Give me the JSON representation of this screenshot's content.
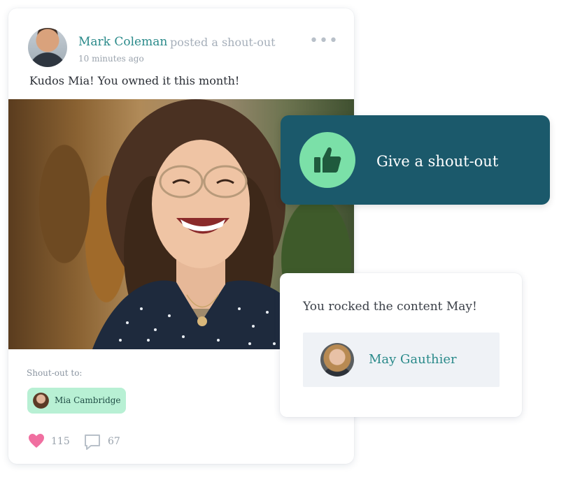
{
  "post": {
    "author_name": "Mark Coleman",
    "action_text": "posted a shout-out",
    "timestamp": "10 minutes ago",
    "more_icon": "ellipsis-icon",
    "message": "Kudos Mia! You owned it this month!",
    "shoutout_label": "Shout-out to:",
    "shoutout_recipient": "Mia Cambridge",
    "likes": "115",
    "comments": "67"
  },
  "cta": {
    "label": "Give a shout-out",
    "icon": "thumbs-up-icon",
    "bg_color": "#1b596b",
    "icon_bg_color": "#7be0a8"
  },
  "mini_card": {
    "message": "You rocked the content May!",
    "recipient_name": "May Gauthier"
  },
  "colors": {
    "accent_teal": "#2a8a8a",
    "chip_green": "#b8f0d4",
    "like_pink": "#f06fa0"
  }
}
